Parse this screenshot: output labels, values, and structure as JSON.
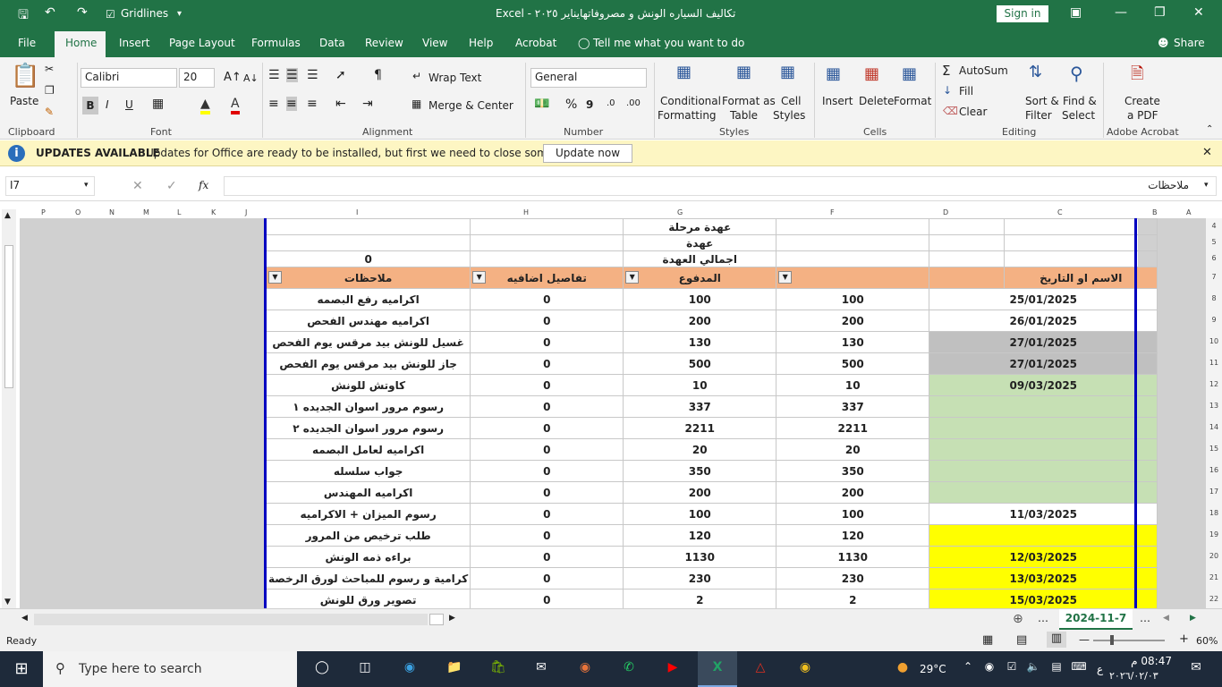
{
  "window": {
    "title": "تكاليف السياره الونش و مصروفاتهايناير ٢٠٢٥  -  Excel",
    "gridlines_label": "Gridlines",
    "signin_label": "Sign in"
  },
  "tabs": [
    "File",
    "Home",
    "Insert",
    "Page Layout",
    "Formulas",
    "Data",
    "Review",
    "View",
    "Help",
    "Acrobat"
  ],
  "tell_me": "Tell me what you want to do",
  "share_label": "Share",
  "ribbon": {
    "clipboard": {
      "paste": "Paste",
      "label": "Clipboard"
    },
    "font": {
      "name": "Calibri",
      "size": "20",
      "label": "Font",
      "bold": "B",
      "italic": "I",
      "underline": "U"
    },
    "alignment": {
      "wrap": "Wrap Text",
      "merge": "Merge & Center",
      "label": "Alignment"
    },
    "number": {
      "format": "General",
      "label": "Number"
    },
    "styles": {
      "conditional": "Conditional",
      "conditional2": "Formatting",
      "format_as": "Format as",
      "format_as2": "Table",
      "cell": "Cell",
      "cell2": "Styles",
      "label": "Styles"
    },
    "cells": {
      "insert": "Insert",
      "delete": "Delete",
      "format": "Format",
      "label": "Cells"
    },
    "editing": {
      "autosum": "AutoSum",
      "fill": "Fill",
      "clear": "Clear",
      "sort": "Sort &",
      "sort2": "Filter",
      "find": "Find &",
      "find2": "Select",
      "label": "Editing"
    },
    "acrobat": {
      "create": "Create",
      "create2": "a PDF",
      "label": "Adobe Acrobat"
    }
  },
  "update_bar": {
    "title": "UPDATES AVAILABLE",
    "message": "Updates for Office are ready to be installed, but first we need to close some apps.",
    "button": "Update now"
  },
  "formula_bar": {
    "name_box": "I7",
    "fx": "fx",
    "content": "ملاحظات"
  },
  "columns_left": [
    "P",
    "O",
    "N",
    "M",
    "L",
    "K",
    "J"
  ],
  "columns_grid": [
    "I",
    "H",
    "G",
    "F",
    "D",
    "C"
  ],
  "columns_right": [
    "B",
    "A"
  ],
  "rows": [
    "4",
    "5",
    "6",
    "7",
    "8",
    "9",
    "10",
    "11",
    "12",
    "13",
    "14",
    "15",
    "16",
    "17",
    "18",
    "19",
    "20",
    "21",
    "22"
  ],
  "sheet": {
    "top_rows": [
      [
        "",
        "",
        "عهدة مرحلة",
        "",
        "",
        ""
      ],
      [
        "",
        "",
        "عهدة",
        "",
        "",
        ""
      ],
      [
        "0",
        "",
        "اجمالي العهدة",
        "",
        "",
        ""
      ]
    ],
    "header": [
      "ملاحظات",
      "تفاصيل اضافيه",
      "المدفوع",
      "",
      "",
      "الاسم او التاريخ"
    ],
    "data_rows": [
      {
        "notes": "اكراميه رفع البصمه",
        "extra": "0",
        "paid": "100",
        "amount": "100",
        "date": "25/01/2025",
        "fill": "#ffffff"
      },
      {
        "notes": "اكراميه مهندس الفحص",
        "extra": "0",
        "paid": "200",
        "amount": "200",
        "date": "26/01/2025",
        "fill": "#ffffff"
      },
      {
        "notes": "غسيل للونش بيد مرقس يوم الفحص",
        "extra": "0",
        "paid": "130",
        "amount": "130",
        "date": "27/01/2025",
        "fill": "#c0c0c0"
      },
      {
        "notes": "جاز للونش بيد مرقس يوم الفحص",
        "extra": "0",
        "paid": "500",
        "amount": "500",
        "date": "27/01/2025",
        "fill": "#c0c0c0"
      },
      {
        "notes": "كاوتش للونش",
        "extra": "0",
        "paid": "10",
        "amount": "10",
        "date": "09/03/2025",
        "fill": "#c6e0b4"
      },
      {
        "notes": "رسوم مرور اسوان الجديده ١",
        "extra": "0",
        "paid": "337",
        "amount": "337",
        "date": "",
        "fill": "#c6e0b4"
      },
      {
        "notes": "رسوم مرور اسوان الجديده ٢",
        "extra": "0",
        "paid": "2211",
        "amount": "2211",
        "date": "",
        "fill": "#c6e0b4"
      },
      {
        "notes": "اكراميه لعامل البصمه",
        "extra": "0",
        "paid": "20",
        "amount": "20",
        "date": "",
        "fill": "#c6e0b4"
      },
      {
        "notes": "جواب سلسله",
        "extra": "0",
        "paid": "350",
        "amount": "350",
        "date": "",
        "fill": "#c6e0b4"
      },
      {
        "notes": "اكراميه المهندس",
        "extra": "0",
        "paid": "200",
        "amount": "200",
        "date": "",
        "fill": "#c6e0b4"
      },
      {
        "notes": "رسوم الميزان + الاكراميه",
        "extra": "0",
        "paid": "100",
        "amount": "100",
        "date": "11/03/2025",
        "fill": "#ffffff"
      },
      {
        "notes": "طلب ترخيص من المرور",
        "extra": "0",
        "paid": "120",
        "amount": "120",
        "date": "",
        "fill": "#ffff00"
      },
      {
        "notes": "براءه ذمه الونش",
        "extra": "0",
        "paid": "1130",
        "amount": "1130",
        "date": "12/03/2025",
        "fill": "#ffff00"
      },
      {
        "notes": "كرامية و رسوم للمباحث لورق الرخصة",
        "extra": "0",
        "paid": "230",
        "amount": "230",
        "date": "13/03/2025",
        "fill": "#ffff00"
      },
      {
        "notes": "تصوير ورق للونش",
        "extra": "0",
        "paid": "2",
        "amount": "2",
        "date": "15/03/2025",
        "fill": "#ffff00"
      }
    ]
  },
  "sheet_tab": "2024-11-7",
  "status": {
    "ready": "Ready",
    "zoom": "60%"
  },
  "taskbar": {
    "search_placeholder": "Type here to search",
    "temp": "29°C",
    "time": "08:47 م",
    "date": "٢٠٢٦/٠٢/٠٣",
    "lang": "ع"
  },
  "colors": {
    "excel_green": "#217346",
    "header_orange": "#f4b183",
    "update_yellow": "#fdf6c3"
  }
}
